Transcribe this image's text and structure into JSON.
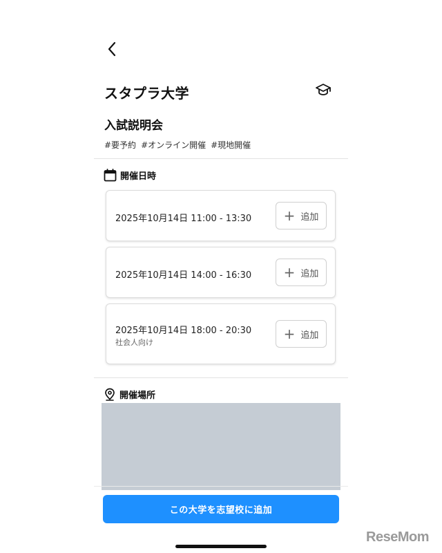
{
  "header": {
    "university_name": "スタプラ大学",
    "event_type": "入試説明会",
    "tags": [
      "#要予約",
      "#オンライン開催",
      "#現地開催"
    ]
  },
  "schedule": {
    "heading": "開催日時",
    "add_label": "追加",
    "slots": [
      {
        "datetime": "2025年10月14日 11:00 - 13:30",
        "note": ""
      },
      {
        "datetime": "2025年10月14日 14:00 - 16:30",
        "note": ""
      },
      {
        "datetime": "2025年10月14日 18:00 - 20:30",
        "note": "社会人向け"
      }
    ]
  },
  "venue": {
    "heading": "開催場所"
  },
  "cta": {
    "label": "この大学を志望校に追加"
  },
  "watermark": {
    "text": "ReseMom"
  },
  "icons": {
    "back": "chevron-left-icon",
    "university": "graduation-cap-icon",
    "calendar": "calendar-icon",
    "location": "location-pin-icon",
    "add": "plus-icon"
  },
  "colors": {
    "accent": "#1e90ff",
    "map_placeholder": "#c5ccd4"
  }
}
